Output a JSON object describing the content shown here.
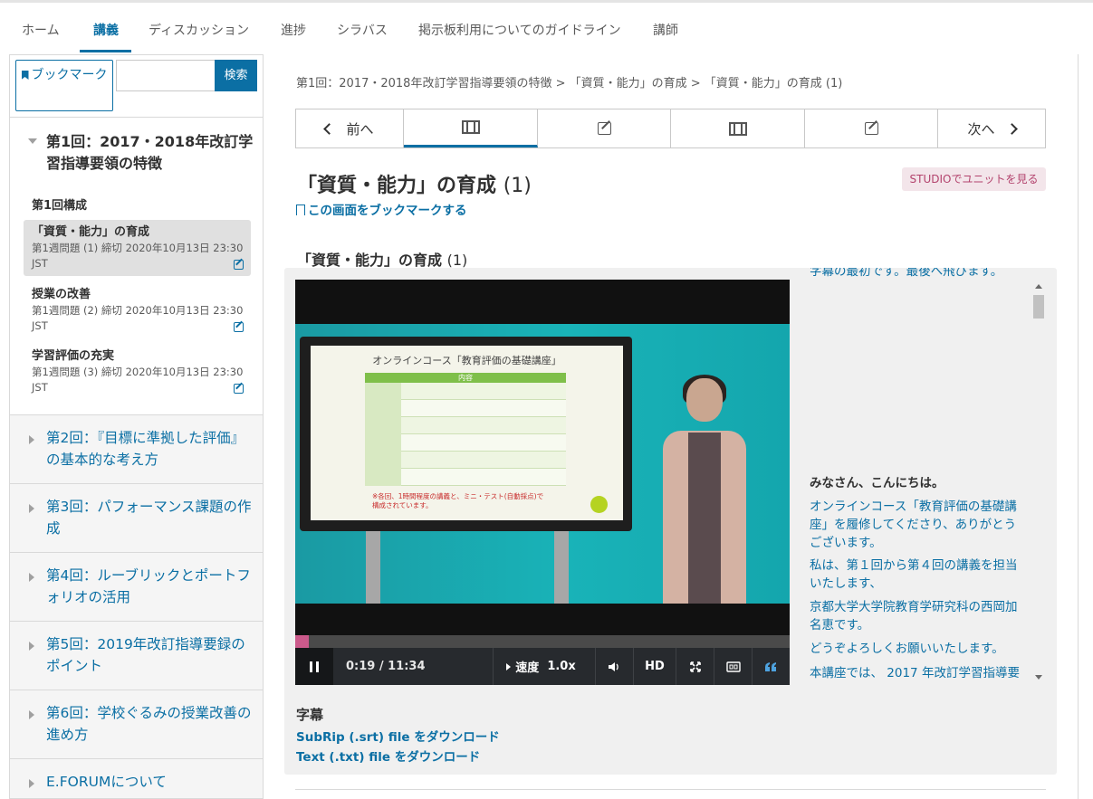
{
  "topnav": {
    "tabs": [
      "ホーム",
      "講義",
      "ディスカッション",
      "進捗",
      "シラバス",
      "掲示板利用についてのガイドライン",
      "講師"
    ]
  },
  "sidebar": {
    "bookmark_button": "ブックマーク",
    "search_placeholder": "",
    "search_button": "検索",
    "unit1": {
      "title": "第1回：2017・2018年改訂学習指導要領の特徴",
      "section": "第1回構成",
      "lessons": [
        {
          "title": "「資質・能力」の育成",
          "meta": "第1週問題 (1) 締切 2020年10月13日 23:30 JST"
        },
        {
          "title": "授業の改善",
          "meta": "第1週問題 (2) 締切 2020年10月13日 23:30 JST"
        },
        {
          "title": "学習評価の充実",
          "meta": "第1週問題 (3) 締切 2020年10月13日 23:30 JST"
        }
      ]
    },
    "weeks": [
      "第2回：『目標に準拠した評価』の基本的な考え方",
      "第3回：パフォーマンス課題の作成",
      "第4回：ルーブリックとポートフォリオの活用",
      "第5回：2019年改訂指導要録のポイント",
      "第6回：学校ぐるみの授業改善の進め方",
      "E.FORUMについて"
    ]
  },
  "main": {
    "breadcrumb": "第1回：2017・2018年改訂学習指導要領の特徴 > 「資質・能力」の育成 > 「資質・能力」の育成 (1)",
    "seq_prev": "前へ",
    "seq_next": "次へ",
    "unit_title": "「資質・能力」の育成",
    "unit_title_num": "(1)",
    "studio_button": "STUDIOでユニットを見る",
    "bookmark_link": "この画面をブックマークする",
    "video_heading": "「資質・能力」の育成",
    "video_heading_num": "(1)"
  },
  "video": {
    "slide_title": "オンラインコース「教育評価の基礎講座」",
    "slide_header": "内容",
    "slide_note_1": "※各回、1時間程度の講義と、ミニ・テスト(自動採点)で",
    "slide_note_2": "構成されています。",
    "time": "0:19 / 11:34",
    "speed_label": "速度",
    "speed_value": "1.0x",
    "hd_label": "HD",
    "progress_fraction": 0.027
  },
  "transcript": {
    "cut_line": "字幕の最初です。最後へ飛びます。",
    "lines": [
      "みなさん、こんにちは。",
      "オンラインコース「教育評価の基礎講座」を履修してくださり、ありがとうございます。",
      "私は、第１回から第４回の講義を担当いたします、",
      "京都大学大学院教育学研究科の西岡加名恵です。",
      "どうぞよろしくお願いいたします。",
      "本講座では、 2017 年改訂学習指導要"
    ]
  },
  "subtitles": {
    "heading": "字幕",
    "srt_link": "SubRip (.srt) file をダウンロード",
    "txt_link": "Text (.txt) file をダウンロード"
  },
  "colors": {
    "accent": "#0b6fa4",
    "studio": "#b3436d",
    "progress": "#cb5a8b"
  }
}
